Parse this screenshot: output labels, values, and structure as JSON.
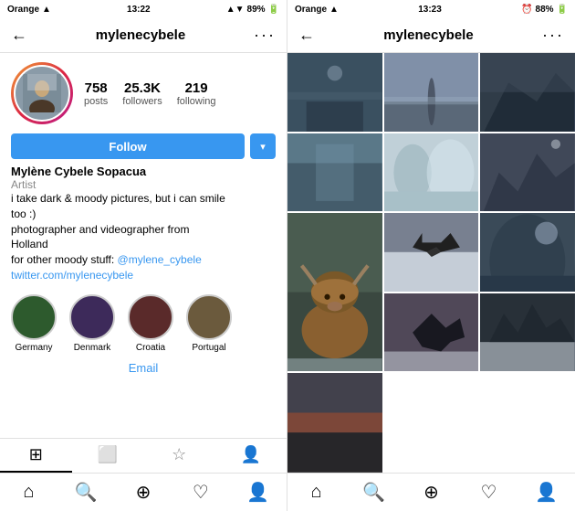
{
  "left": {
    "statusBar": {
      "carrier": "Orange",
      "time": "13:22",
      "signal": "▲▼",
      "battery": "89%"
    },
    "nav": {
      "backIcon": "←",
      "username": "mylenecybele",
      "moreIcon": "···"
    },
    "profile": {
      "stats": [
        {
          "number": "758",
          "label": "posts"
        },
        {
          "number": "25.3K",
          "label": "followers"
        },
        {
          "number": "219",
          "label": "following"
        }
      ],
      "followButton": "Follow",
      "dropdownIcon": "▾",
      "name": "Mylène Cybele Sopacua",
      "title": "Artist",
      "bio1": "i take dark & moody pictures, but i can smile",
      "bio2": "too :)",
      "bio3": "photographer and videographer from",
      "bio4": "Holland",
      "bio5": "for other moody stuff: ",
      "bioLink1": "@mylene_cybele",
      "bioLink2": "twitter.com/mylenecybele"
    },
    "highlights": [
      {
        "label": "Germany"
      },
      {
        "label": "Denmark"
      },
      {
        "label": "Croatia"
      },
      {
        "label": "Portugal"
      }
    ],
    "emailLabel": "Email",
    "tabs": [
      {
        "icon": "⊞",
        "active": true
      },
      {
        "icon": "⬜",
        "active": false
      },
      {
        "icon": "☆",
        "active": false
      },
      {
        "icon": "👤",
        "active": false
      }
    ],
    "bottomNav": [
      {
        "icon": "⌂"
      },
      {
        "icon": "🔍"
      },
      {
        "icon": "⊕"
      },
      {
        "icon": "♡"
      },
      {
        "icon": "👤"
      }
    ]
  },
  "right": {
    "statusBar": {
      "carrier": "Orange",
      "time": "13:23",
      "battery": "88%"
    },
    "nav": {
      "backIcon": "←",
      "username": "mylenecybele",
      "moreIcon": "···"
    },
    "bottomNav": [
      {
        "icon": "⌂"
      },
      {
        "icon": "🔍"
      },
      {
        "icon": "⊕"
      },
      {
        "icon": "♡"
      },
      {
        "icon": "👤"
      }
    ]
  }
}
